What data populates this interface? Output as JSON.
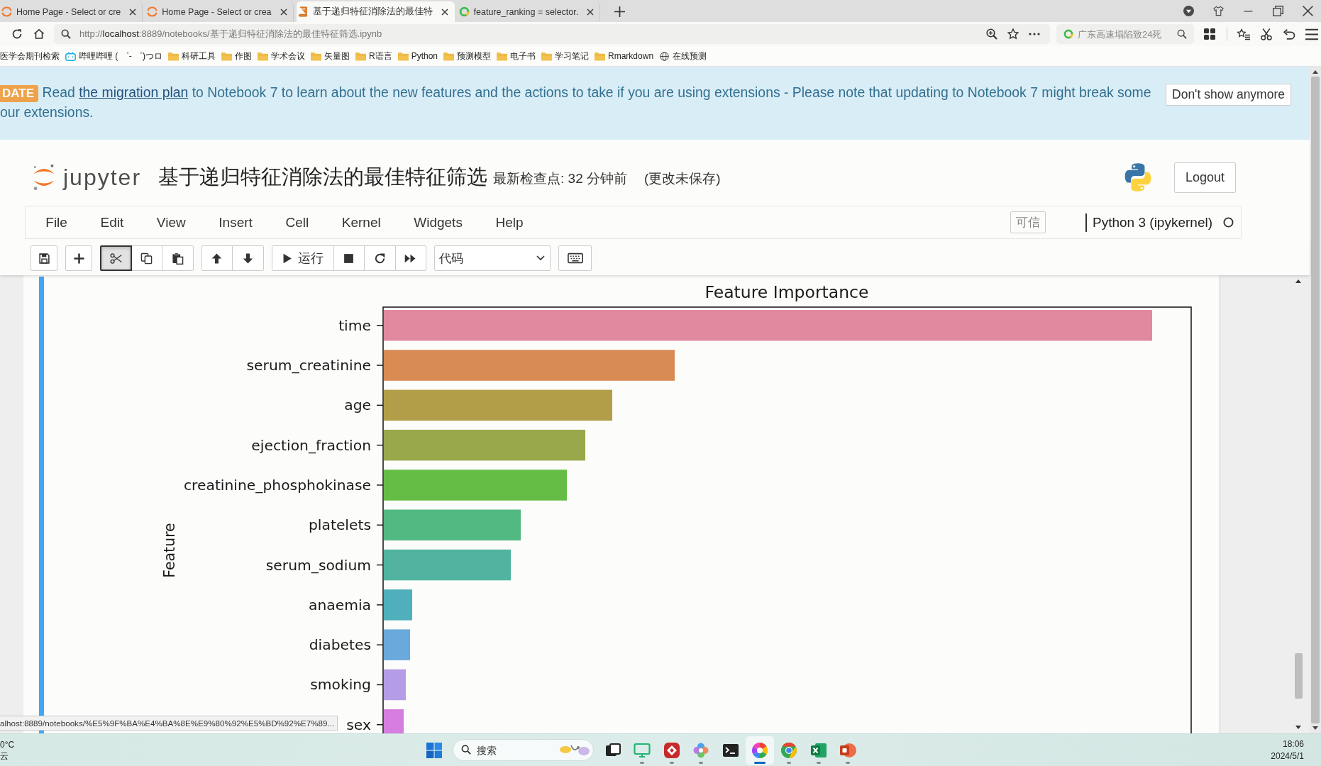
{
  "browser": {
    "tabs": [
      {
        "title": "Home Page - Select or cre",
        "kind": "jupyter",
        "selected": false
      },
      {
        "title": "Home Page - Select or crea",
        "kind": "jupyter",
        "selected": false
      },
      {
        "title": "基于递归特征消除法的最佳特",
        "kind": "notebook",
        "selected": true
      },
      {
        "title": "feature_ranking = selector.",
        "kind": "search",
        "selected": false
      }
    ],
    "address": {
      "scheme": "http://",
      "host": "localhost",
      "path": ":8889/notebooks/基于递归特征消除法的最佳特征筛选.ipynb"
    },
    "search": {
      "placeholder": "广东高速塌陷致24死"
    },
    "bookmarks": [
      {
        "label": "医学会期刊检索",
        "kind": "plain"
      },
      {
        "label": "哔哩哔哩 ( ゜- ゜)つロ",
        "kind": "tv"
      },
      {
        "label": "科研工具",
        "kind": "folder"
      },
      {
        "label": "作图",
        "kind": "folder"
      },
      {
        "label": "学术会议",
        "kind": "folder"
      },
      {
        "label": "矢量图",
        "kind": "folder"
      },
      {
        "label": "R语言",
        "kind": "folder"
      },
      {
        "label": "Python",
        "kind": "folder"
      },
      {
        "label": "预测模型",
        "kind": "folder"
      },
      {
        "label": "电子书",
        "kind": "folder"
      },
      {
        "label": "学习笔记",
        "kind": "folder"
      },
      {
        "label": "Rmarkdown",
        "kind": "folder"
      },
      {
        "label": "在线预测",
        "kind": "globe"
      }
    ]
  },
  "banner": {
    "badge": "DATE",
    "before_link": "Read ",
    "link": "the migration plan",
    "after_link": " to Notebook 7 to learn about the new features and the actions to take if you are using extensions - Please note that updating to Notebook 7 might break some",
    "continuation": "our extensions.",
    "button": "Don't show anymore"
  },
  "header": {
    "logo_text": "jupyter",
    "title": "基于递归特征消除法的最佳特征筛选",
    "checkpoint": "最新检查点: 32 分钟前",
    "autosave": "(更改未保存)",
    "logout": "Logout"
  },
  "menubar": {
    "items": [
      "File",
      "Edit",
      "View",
      "Insert",
      "Cell",
      "Kernel",
      "Widgets",
      "Help"
    ],
    "trusted": "可信",
    "kernel": {
      "name": "Python 3 (ipykernel)",
      "busy": false
    }
  },
  "toolbar": {
    "items": [
      {
        "kind": "group",
        "buttons": [
          {
            "kind": "save",
            "active": false
          }
        ]
      },
      {
        "kind": "group",
        "buttons": [
          {
            "kind": "insert",
            "active": false
          }
        ]
      },
      {
        "kind": "group",
        "buttons": [
          {
            "kind": "cut",
            "active": true
          },
          {
            "kind": "copy",
            "active": false
          },
          {
            "kind": "paste",
            "active": false
          }
        ]
      },
      {
        "kind": "group",
        "buttons": [
          {
            "kind": "up",
            "active": false
          },
          {
            "kind": "down",
            "active": false
          }
        ]
      },
      {
        "kind": "group",
        "buttons": [
          {
            "kind": "run",
            "label": "运行",
            "active": false
          },
          {
            "kind": "stop",
            "active": false
          },
          {
            "kind": "restart",
            "active": false
          },
          {
            "kind": "run_all",
            "active": false
          }
        ]
      },
      {
        "kind": "select",
        "value": "代码"
      },
      {
        "kind": "group",
        "buttons": [
          {
            "kind": "keyboard",
            "active": false
          }
        ]
      }
    ]
  },
  "cell_output": {
    "chart": {
      "title": "Feature Importance",
      "ylabel": "Feature",
      "bars": [
        {
          "label": "time",
          "color": "#e0899f"
        },
        {
          "label": "serum_creatinine",
          "color": "#d98b54"
        },
        {
          "label": "age",
          "color": "#b29e48"
        },
        {
          "label": "ejection_fraction",
          "color": "#99a84a"
        },
        {
          "label": "creatinine_phosphokinase",
          "color": "#66bd46"
        },
        {
          "label": "platelets",
          "color": "#52b983"
        },
        {
          "label": "serum_sodium",
          "color": "#52b4a0"
        },
        {
          "label": "anaemia",
          "color": "#4fb0bb"
        },
        {
          "label": "diabetes",
          "color": "#6aa9dc"
        },
        {
          "label": "smoking",
          "color": "#b49de6"
        },
        {
          "label": "sex",
          "color": "#d77de0"
        }
      ]
    }
  },
  "status_link": "alhost:8889/notebooks/%E5%9F%BA%E4%BA%8E%E9%80%92%E5%BD%92%E7%89...",
  "taskbar": {
    "weather": {
      "temperature": "0°C",
      "condition": "云"
    },
    "search": {
      "placeholder": "搜索"
    },
    "apps": [
      {
        "kind": "task_view",
        "running": false,
        "selected": false
      },
      {
        "kind": "monitor",
        "running": true,
        "selected": false
      },
      {
        "kind": "tile",
        "running": true,
        "selected": false
      },
      {
        "kind": "flower",
        "running": true,
        "selected": false
      },
      {
        "kind": "terminal",
        "running": false,
        "selected": false
      },
      {
        "kind": "wheel",
        "running": true,
        "selected": true
      },
      {
        "kind": "browser",
        "running": true,
        "selected": false
      },
      {
        "kind": "sheet",
        "running": true,
        "selected": false
      },
      {
        "kind": "slides",
        "running": true,
        "selected": false
      }
    ],
    "clock": {
      "time": "18:06",
      "date": "2024/5/1"
    }
  }
}
